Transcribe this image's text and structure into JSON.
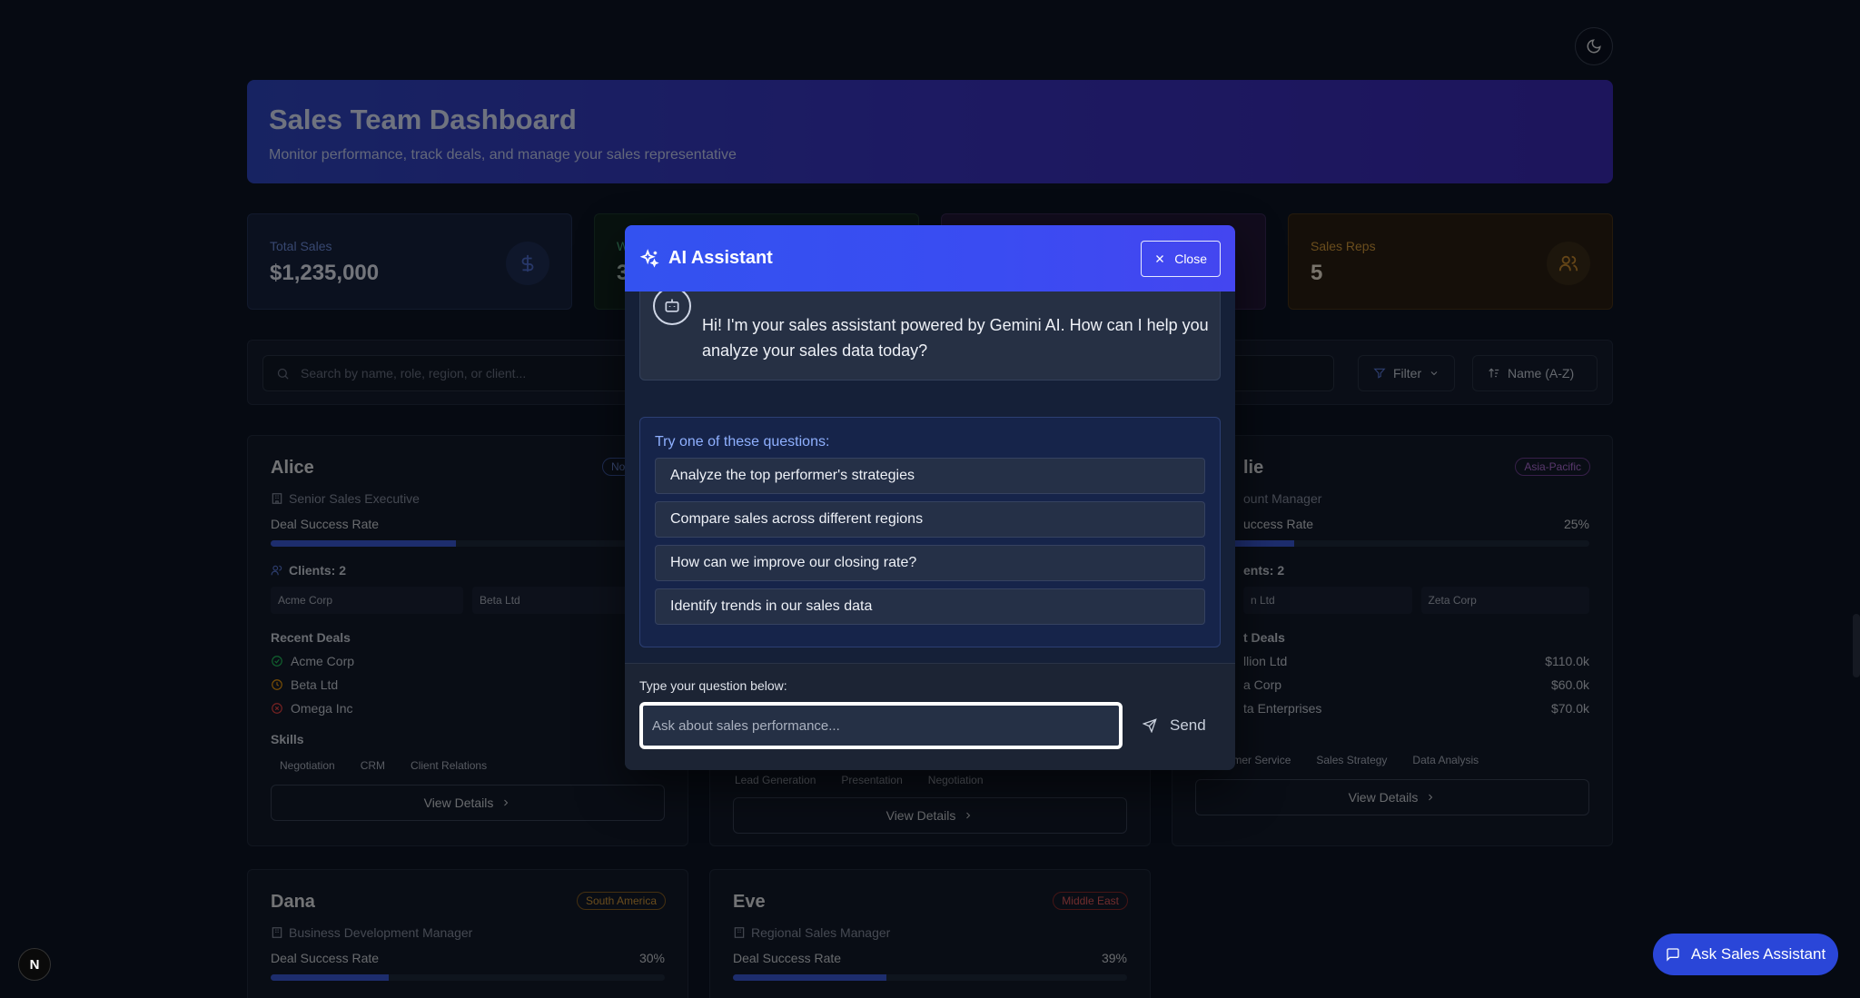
{
  "header": {
    "title": "Sales Team Dashboard",
    "subtitle": "Monitor performance, track deals, and manage your sales representative"
  },
  "stats": {
    "total_sales": {
      "label": "Total Sales",
      "value": "$1,235,000"
    },
    "stat2": {
      "label": "W",
      "value": "3"
    },
    "sales_reps": {
      "label": "Sales Reps",
      "value": "5"
    }
  },
  "toolbar": {
    "search_placeholder": "Search by name, role, region, or client...",
    "filter_label": "Filter",
    "sort_label": "Name (A-Z)"
  },
  "cards": {
    "alice": {
      "name": "Alice",
      "region": "North Am",
      "role": "Senior Sales Executive",
      "rate_label": "Deal Success Rate",
      "rate_value": 0.47,
      "clients_label": "Clients: 2",
      "clients": [
        "Acme Corp",
        "Beta Ltd"
      ],
      "deals_label": "Recent Deals",
      "deals": [
        {
          "name": "Acme Corp",
          "amount": "$"
        },
        {
          "name": "Beta Ltd",
          "amount": ""
        },
        {
          "name": "Omega Inc",
          "amount": ""
        }
      ],
      "skills_label": "Skills",
      "skills": [
        "Negotiation",
        "CRM",
        "Client Relations"
      ],
      "details_label": "View Details"
    },
    "bob": {
      "skills": [
        "Lead Generation",
        "Presentation",
        "Negotiation"
      ],
      "details_label": "View Details"
    },
    "charlie": {
      "name": "lie",
      "region": "Asia-Pacific",
      "role": "ount Manager",
      "rate_label": "uccess Rate",
      "rate_text": "25%",
      "rate_value": 0.25,
      "clients_label": "ents: 2",
      "clients": [
        "n Ltd",
        "Zeta Corp"
      ],
      "deals_label": "t Deals",
      "deals": [
        {
          "name": "llion Ltd",
          "amount": "$110.0k"
        },
        {
          "name": "a Corp",
          "amount": "$60.0k"
        },
        {
          "name": "ta Enterprises",
          "amount": "$70.0k"
        }
      ],
      "skills": [
        "Customer Service",
        "Sales Strategy",
        "Data Analysis"
      ],
      "details_label": "View Details"
    },
    "dana": {
      "name": "Dana",
      "region": "South America",
      "role": "Business Development Manager",
      "rate_label": "Deal Success Rate",
      "rate_text": "30%",
      "rate_value": 0.3
    },
    "eve": {
      "name": "Eve",
      "region": "Middle East",
      "role": "Regional Sales Manager",
      "rate_label": "Deal Success Rate",
      "rate_text": "39%",
      "rate_value": 0.39
    }
  },
  "modal": {
    "title": "AI Assistant",
    "close_label": "Close",
    "greeting": "Hi! I'm your sales assistant powered by Gemini AI. How can I help you analyze your sales data today?",
    "suggestions_title": "Try one of these questions:",
    "suggestions": [
      "Analyze the top performer's strategies",
      "Compare sales across different regions",
      "How can we improve our closing rate?",
      "Identify trends in our sales data"
    ],
    "input_label": "Type your question below:",
    "input_placeholder": "Ask about sales performance...",
    "send_label": "Send"
  },
  "floating": {
    "ask_label": "Ask Sales Assistant",
    "logo_letter": "N"
  },
  "colors": {
    "accent": "#3352f0",
    "success": "#22c55e",
    "pending": "#f59e0b",
    "failed": "#ef4444"
  }
}
